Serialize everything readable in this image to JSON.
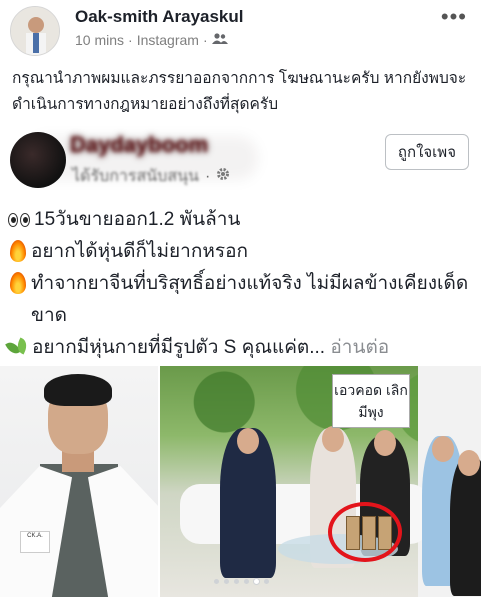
{
  "post": {
    "author": "Oak-smith Arayaskul",
    "time": "10 mins",
    "separator": "·",
    "source": "Instagram",
    "text": "กรุณานำภาพผมและภรรยาออกจากการ โฆษณานะครับ หากยังพบจะดำเนินการทางกฎหมายอย่างถึงที่สุดครับ"
  },
  "shared_ad": {
    "page_name": "Daydayboom",
    "sponsored": "ได้รับการสนับสนุน",
    "like_page_label": "ถูกใจเพจ",
    "lines": [
      {
        "emoji": "eyes-icon",
        "text": "15วันขายออก1.2 พันล้าน"
      },
      {
        "emoji": "fire-icon",
        "text": "อยากได้หุ่นดีก็ไม่ยากหรอก"
      },
      {
        "emoji": "fire-icon",
        "text": "ทำจากยาจีนที่บริสุทธิ์อย่างแท้จริง ไม่มีผลข้างเคียงเด็ดขาด"
      },
      {
        "emoji": "herb-icon",
        "text": "อยากมีหุ่นกายที่มีรูปตัว S คุณแค่ต..."
      }
    ],
    "see_more": "อ่านต่อ",
    "promo_sign": "เอวคอด เลิกมีพุง",
    "coat_badge": "CK.A.",
    "carousel_count": 6,
    "carousel_active": 4
  },
  "colors": {
    "accent_red": "#e3141b",
    "meta_gray": "#7f7f7f"
  }
}
